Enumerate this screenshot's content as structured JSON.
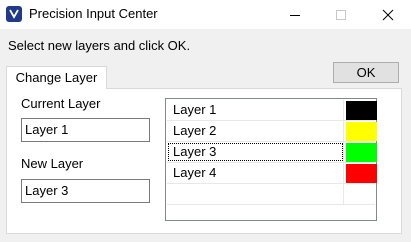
{
  "window": {
    "title": "Precision Input Center",
    "icon": "app-icon"
  },
  "instruction": "Select new layers and click OK.",
  "ok_button": {
    "label": "OK"
  },
  "tabs": [
    {
      "label": "Change Layer",
      "active": true
    }
  ],
  "current_layer": {
    "label": "Current Layer",
    "value": "Layer 1"
  },
  "new_layer": {
    "label": "New Layer",
    "value": "Layer 3"
  },
  "layers": [
    {
      "name": "Layer 1",
      "color": "#000000"
    },
    {
      "name": "Layer 2",
      "color": "#ffff00",
      "focused": false
    },
    {
      "name": "Layer 3",
      "color": "#00ff00",
      "focused": true
    },
    {
      "name": "Layer 4",
      "color": "#ff0000"
    }
  ]
}
